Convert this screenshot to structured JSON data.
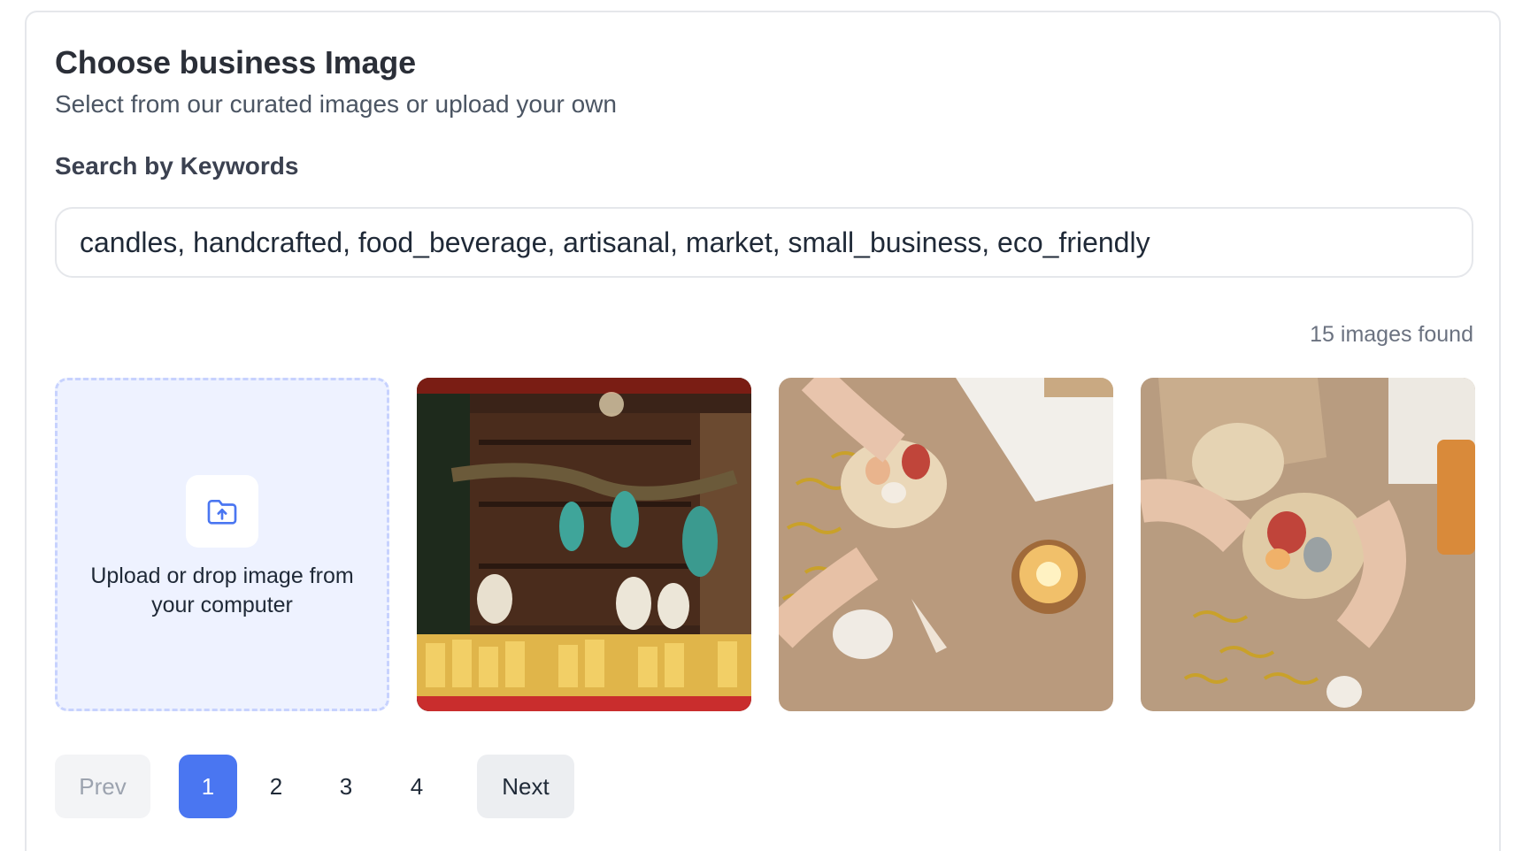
{
  "header": {
    "title": "Choose business Image",
    "subtitle": "Select from our curated images or upload your own"
  },
  "search": {
    "label": "Search by Keywords",
    "value": "candles, handcrafted, food_beverage, artisanal, market, small_business, eco_friendly"
  },
  "results": {
    "count_text": "15 images found"
  },
  "upload": {
    "icon": "folder-upload-icon",
    "text": "Upload or drop image from your computer"
  },
  "images": [
    {
      "subject": "candle market stall"
    },
    {
      "subject": "hands holding box of seashells with candle"
    },
    {
      "subject": "hands opening round box with seashells"
    }
  ],
  "pagination": {
    "prev_label": "Prev",
    "next_label": "Next",
    "pages": [
      "1",
      "2",
      "3",
      "4"
    ],
    "current_page": "1"
  },
  "colors": {
    "accent": "#4a76f1",
    "upload_bg": "#eef2ff",
    "upload_border": "#c7d2fe"
  }
}
